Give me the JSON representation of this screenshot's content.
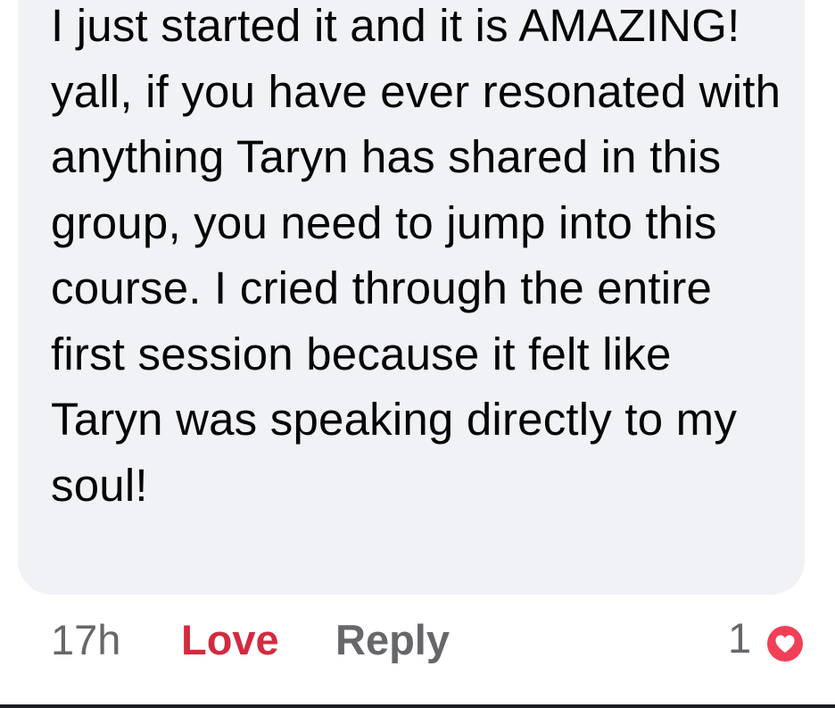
{
  "comment": {
    "text": "I just started it and it is AMAZING! yall, if you have ever resonated with anything Taryn has shared in this group, you need to jump into this course. I cried through the entire first session because it felt like Taryn was speaking directly to my soul!"
  },
  "actions": {
    "time": "17h",
    "love_label": "Love",
    "reply_label": "Reply",
    "reaction_count": "1",
    "reaction_icon": "heart-love-icon"
  },
  "colors": {
    "bubble_bg": "#f0f2f5",
    "text": "#050505",
    "muted": "#65676b",
    "love_active": "#d42a40",
    "love_reaction": "#f33e58"
  }
}
